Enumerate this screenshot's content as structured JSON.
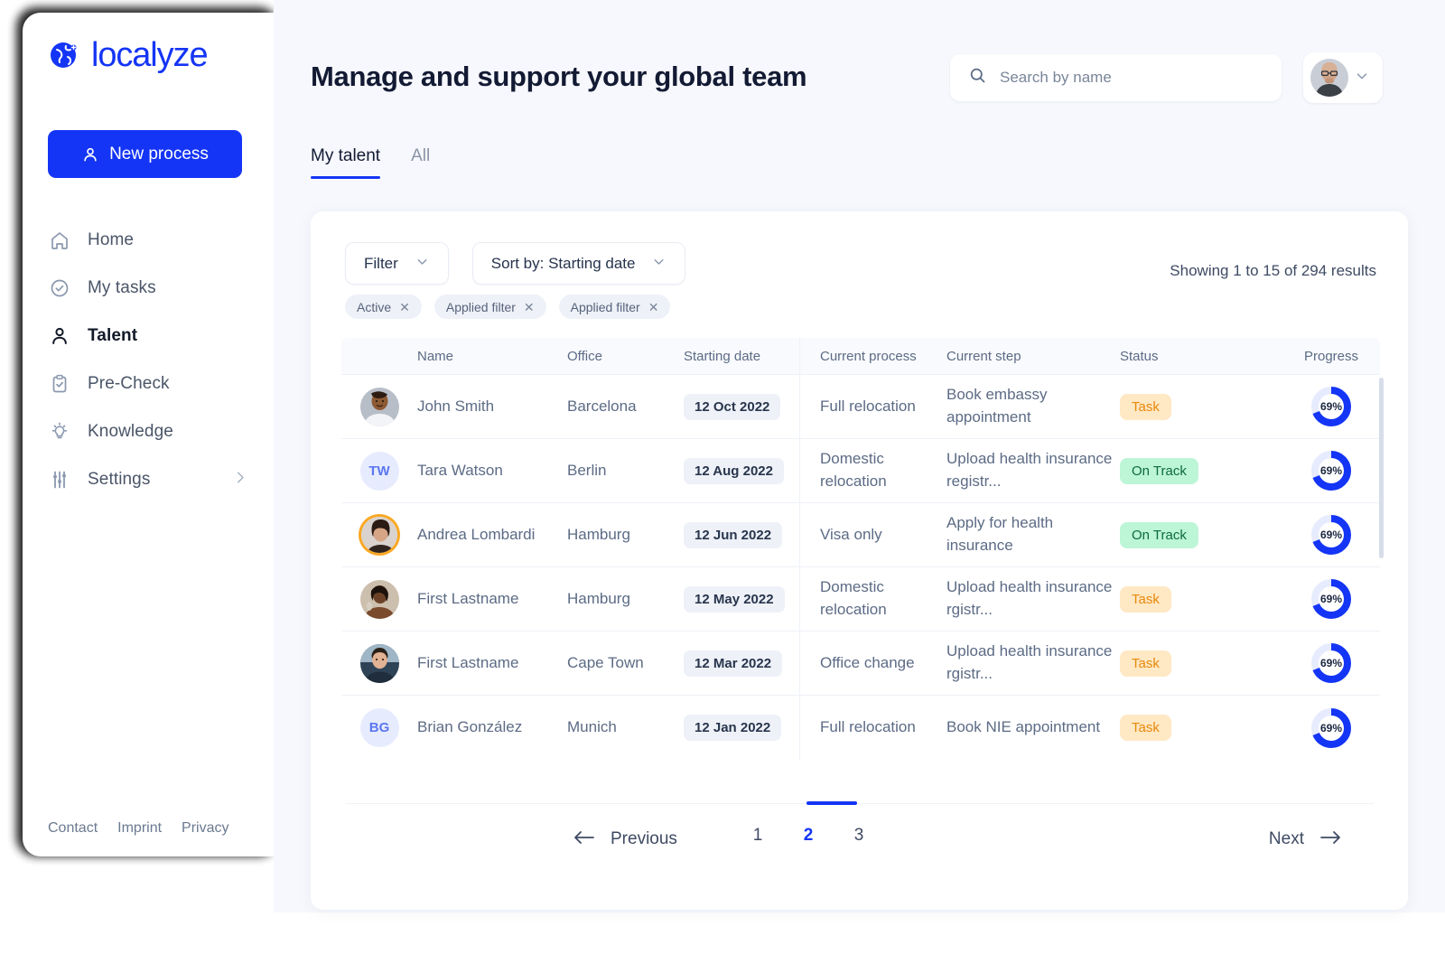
{
  "brand": {
    "name": "localyze",
    "color": "#1435f5",
    "icon": "globe-icon"
  },
  "sidebar": {
    "new_process_label": "New process",
    "items": [
      {
        "label": "Home",
        "icon": "home-icon",
        "active": false
      },
      {
        "label": "My tasks",
        "icon": "check-circle-icon",
        "active": false
      },
      {
        "label": "Talent",
        "icon": "user-icon",
        "active": true
      },
      {
        "label": "Pre-Check",
        "icon": "clipboard-check-icon",
        "active": false
      },
      {
        "label": "Knowledge",
        "icon": "lightbulb-icon",
        "active": false
      },
      {
        "label": "Settings",
        "icon": "sliders-icon",
        "active": false,
        "chevron": "chevron-right-icon"
      }
    ],
    "footer_links": [
      "Contact",
      "Imprint",
      "Privacy"
    ]
  },
  "header": {
    "title": "Manage and support your global team",
    "search": {
      "placeholder": "Search by name",
      "value": "",
      "icon": "search-icon"
    },
    "avatar_menu": {
      "icon": "avatar",
      "chevron": "chevron-down-icon"
    }
  },
  "tabs": [
    {
      "label": "My talent",
      "active": true
    },
    {
      "label": "All",
      "active": false
    }
  ],
  "controls": {
    "filter": {
      "label": "Filter",
      "icon": "chevron-down-icon"
    },
    "sort": {
      "label": "Sort by: Starting date",
      "icon": "chevron-down-icon"
    },
    "chips": [
      {
        "label": "Active",
        "remove_icon": "close-icon"
      },
      {
        "label": "Applied filter",
        "remove_icon": "close-icon"
      },
      {
        "label": "Applied filter",
        "remove_icon": "close-icon"
      }
    ],
    "showing": "Showing 1 to 15 of 294 results"
  },
  "table": {
    "columns": [
      "",
      "Name",
      "Office",
      "Starting date",
      "Current process",
      "Current step",
      "Status",
      "Progress"
    ],
    "rows": [
      {
        "avatar": {
          "type": "photo",
          "tone": "#b6723f",
          "ring": false
        },
        "name": "John Smith",
        "office": "Barcelona",
        "date": "12 Oct 2022",
        "process": "Full relocation",
        "step": "Book embassy appointment",
        "status": {
          "label": "Task",
          "kind": "task"
        },
        "progress": "69%",
        "progress_value": 69
      },
      {
        "avatar": {
          "type": "initials",
          "initials": "TW"
        },
        "name": "Tara Watson",
        "office": "Berlin",
        "date": "12 Aug 2022",
        "process": "Domestic relocation",
        "step": "Upload health insurance registr...",
        "status": {
          "label": "On Track",
          "kind": "ontrack"
        },
        "progress": "69%",
        "progress_value": 69
      },
      {
        "avatar": {
          "type": "photo",
          "tone": "#4a3a33",
          "ring": true,
          "ring_color": "#f9a825"
        },
        "name": "Andrea Lombardi",
        "office": "Hamburg",
        "date": "12 Jun 2022",
        "process": "Visa only",
        "step": "Apply for health insurance",
        "status": {
          "label": "On Track",
          "kind": "ontrack"
        },
        "progress": "69%",
        "progress_value": 69
      },
      {
        "avatar": {
          "type": "photo",
          "tone": "#8a6246",
          "ring": false
        },
        "name": "First Lastname",
        "office": "Hamburg",
        "date": "12 May 2022",
        "process": "Domestic relocation",
        "step": "Upload health insurance rgistr...",
        "status": {
          "label": "Task",
          "kind": "task"
        },
        "progress": "69%",
        "progress_value": 69
      },
      {
        "avatar": {
          "type": "photo",
          "tone": "#3d4a5c",
          "ring": false
        },
        "name": "First Lastname",
        "office": "Cape Town",
        "date": "12 Mar 2022",
        "process": "Office change",
        "step": "Upload health insurance rgistr...",
        "status": {
          "label": "Task",
          "kind": "task"
        },
        "progress": "69%",
        "progress_value": 69
      },
      {
        "avatar": {
          "type": "initials",
          "initials": "BG"
        },
        "name": "Brian González",
        "office": "Munich",
        "date": "12 Jan 2022",
        "process": "Full relocation",
        "step": "Book NIE appointment",
        "status": {
          "label": "Task",
          "kind": "task"
        },
        "progress": "69%",
        "progress_value": 69
      }
    ]
  },
  "pagination": {
    "previous_label": "Previous",
    "next_label": "Next",
    "prev_icon": "arrow-left-icon",
    "next_icon": "arrow-right-icon",
    "pages": [
      "1",
      "2",
      "3"
    ],
    "current_page": "2"
  },
  "colors": {
    "accent": "#1435f5",
    "task_bg": "#ffe8c4",
    "task_fg": "#e8890b",
    "ontrack_bg": "#bdf5d7",
    "ontrack_fg": "#0d6b3e",
    "page_bg": "#f6f8fd"
  }
}
